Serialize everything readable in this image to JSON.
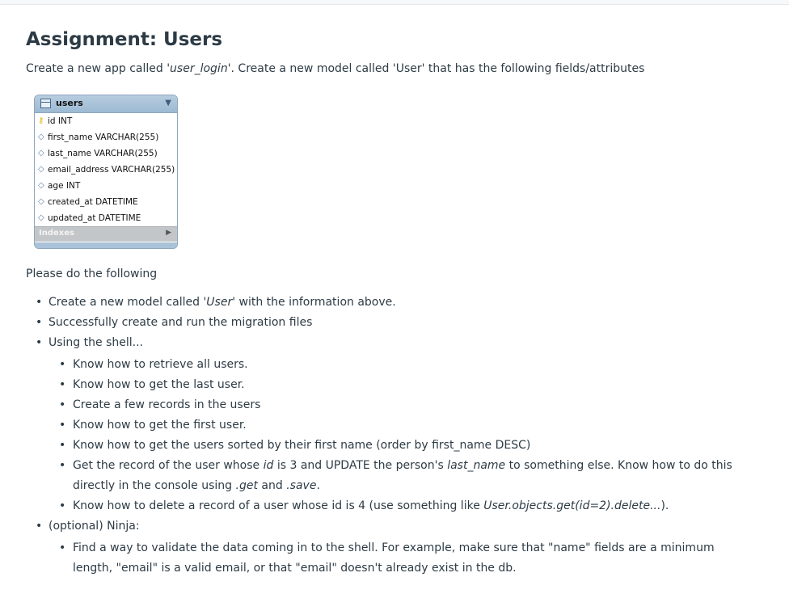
{
  "title": "Assignment: Users",
  "intro": {
    "part1": "Create a new app called '",
    "app_name": "user_login",
    "part2": "'. Create a new model called 'User' that has the following fields/attributes"
  },
  "db_table": {
    "name": "users",
    "fields": [
      {
        "text": "id INT",
        "icon": "key-icon"
      },
      {
        "text": "first_name VARCHAR(255)",
        "icon": "diamond-icon"
      },
      {
        "text": "last_name VARCHAR(255)",
        "icon": "diamond-icon"
      },
      {
        "text": "email_address VARCHAR(255)",
        "icon": "diamond-icon"
      },
      {
        "text": "age INT",
        "icon": "diamond-icon"
      },
      {
        "text": "created_at DATETIME",
        "icon": "diamond-icon"
      },
      {
        "text": "updated_at DATETIME",
        "icon": "diamond-icon"
      }
    ],
    "footer_label": "Indexes"
  },
  "please": "Please do the following",
  "items": {
    "i1_a": "Create a new model called ",
    "i1_b": "'User'",
    "i1_c": " with the information above.",
    "i2": "Successfully create and run the migration files",
    "i3": "Using the shell...",
    "s1": "Know how to retrieve all users.",
    "s2": "Know how to get the last user.",
    "s3": "Create a few records in the users",
    "s4": "Know how to get the first user.",
    "s5": "Know how to get the users sorted by their first name (order by first_name DESC)",
    "s6_a": "Get the record of the user whose ",
    "s6_b": "id",
    "s6_c": " is 3 and UPDATE the person's ",
    "s6_d": "last_name",
    "s6_e": " to something else. Know how to do this directly in the console using ",
    "s6_f": ".get",
    "s6_g": " and ",
    "s6_h": ".save",
    "s6_i": ".",
    "s7_a": "Know how to delete a record of a user whose id is 4 (use something like ",
    "s7_b": "User.objects.get(id=2).delete...",
    "s7_c": ").",
    "i4": "(optional) Ninja:",
    "n1": "Find a way to validate the data coming in to the shell.  For example, make sure that \"name\" fields are a minimum length, \"email\" is a valid email, or that \"email\" doesn't already exist in the db."
  }
}
